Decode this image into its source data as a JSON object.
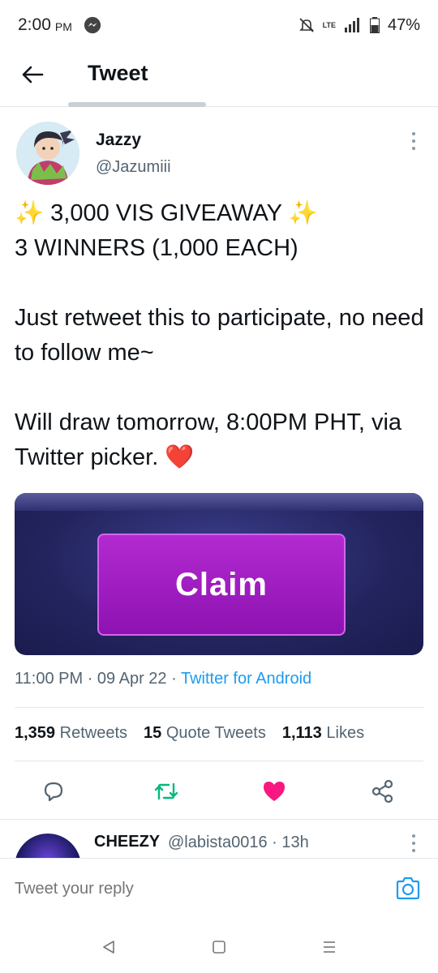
{
  "status_bar": {
    "time": "2:00",
    "ampm": "PM",
    "network": "LTE",
    "battery": "47%"
  },
  "header": {
    "title": "Tweet"
  },
  "tweet": {
    "author_name": "Jazzy",
    "author_handle": "@Jazumiii",
    "text": "✨ 3,000 VIS GIVEAWAY ✨\n3 WINNERS (1,000 EACH)\n\nJust retweet this to participate, no need to follow me~\n\nWill draw tomorrow, 8:00PM PHT, via Twitter picker. ❤️",
    "media_button_label": "Claim",
    "time": "11:00 PM",
    "date": "09 Apr 22",
    "source": "Twitter for Android",
    "retweets_count": "1,359",
    "retweets_label": "Retweets",
    "quotes_count": "15",
    "quotes_label": "Quote Tweets",
    "likes_count": "1,113",
    "likes_label": "Likes"
  },
  "reply": {
    "name": "CHEEZY",
    "handle": "@labista0016",
    "time": "13h"
  },
  "compose": {
    "placeholder": "Tweet your reply"
  },
  "colors": {
    "accent": "#1d9bf0",
    "like": "#f91880",
    "retweet": "#00ba7c",
    "claim": "#a01fc4"
  }
}
